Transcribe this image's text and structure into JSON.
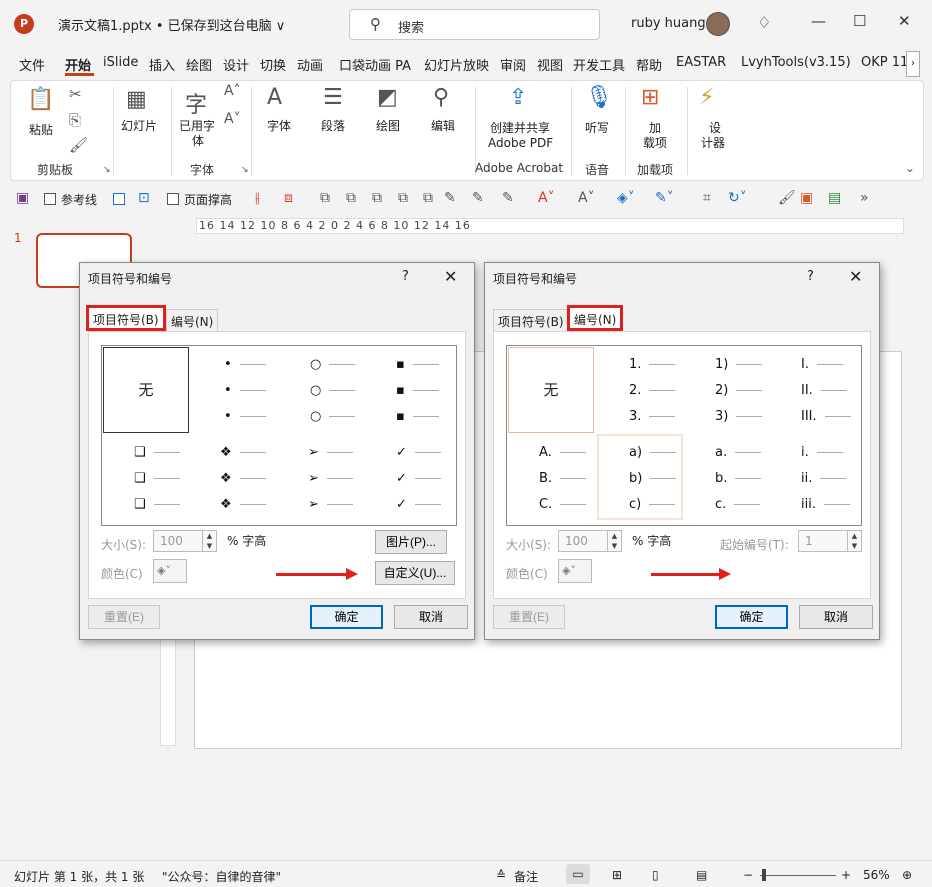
{
  "titlebar": {
    "app_icon": "P",
    "doc_title": "演示文稿1.pptx • 已保存到这台电脑 ∨",
    "search_placeholder": "搜索",
    "user_name": "ruby huang",
    "icons": [
      "search-icon",
      "diamond-icon",
      "minimize-icon",
      "maximize-icon",
      "close-icon"
    ]
  },
  "menu": [
    "文件",
    "开始",
    "iSlide",
    "插入",
    "绘图",
    "设计",
    "切换",
    "动画",
    "口袋动画 PA",
    "幻灯片放映",
    "审阅",
    "视图",
    "开发工具",
    "帮助",
    "EASTAR",
    "LvyhTools(v3.15)",
    "OKP 11"
  ],
  "ribbon": {
    "buttons": [
      "粘贴",
      "幻灯片",
      "已用字",
      "体",
      "字体",
      "段落",
      "绘图",
      "编辑",
      "创建并共享",
      "Adobe PDF",
      "听写",
      "加",
      "载项",
      "设",
      "计器"
    ],
    "groups": [
      "剪贴板",
      "字体",
      "Adobe Acrobat",
      "语音",
      "加载项"
    ]
  },
  "qat": {
    "guides_label": "参考线",
    "page_height_label": "页面撑高"
  },
  "ruler": "16 14 12 10 8 6 4 2 0 2 4 6 8 10 12 14 16",
  "thumbnail": {
    "number": "1"
  },
  "status": {
    "slide_info": "幻灯片 第 1 张，共 1 张",
    "note": "\"公众号：自律的音律\"",
    "notes_label": "备注",
    "zoom": "56%"
  },
  "dialog_left": {
    "title": "项目符号和编号",
    "help": "?",
    "close": "✕",
    "tab_bullets": "项目符号(B)",
    "tab_numbering": "编号(N)",
    "none_label": "无",
    "bullet_symbols": [
      "•",
      "○",
      "▪",
      "❑",
      "❖",
      "➢",
      "✓"
    ],
    "size_label": "大小(S):",
    "size_value": "100",
    "pct_label": "% 字高",
    "color_label": "颜色(C)",
    "picture_button": "图片(P)...",
    "custom_button": "自定义(U)...",
    "reset_button": "重置(E)",
    "ok_button": "确定",
    "cancel_button": "取消"
  },
  "dialog_right": {
    "title": "项目符号和编号",
    "help": "?",
    "close": "✕",
    "tab_bullets": "项目符号(B)",
    "tab_numbering": "编号(N)",
    "none_label": "无",
    "numbering_sets": [
      [
        "1.",
        "2.",
        "3."
      ],
      [
        "1)",
        "2)",
        "3)"
      ],
      [
        "I.",
        "II.",
        "III."
      ],
      [
        "A.",
        "B.",
        "C."
      ],
      [
        "a)",
        "b)",
        "c)"
      ],
      [
        "a.",
        "b.",
        "c."
      ],
      [
        "i.",
        "ii.",
        "iii."
      ]
    ],
    "size_label": "大小(S):",
    "size_value": "100",
    "pct_label": "% 字高",
    "color_label": "颜色(C)",
    "start_label": "起始编号(T):",
    "start_value": "1",
    "reset_button": "重置(E)",
    "ok_button": "确定",
    "cancel_button": "取消"
  }
}
